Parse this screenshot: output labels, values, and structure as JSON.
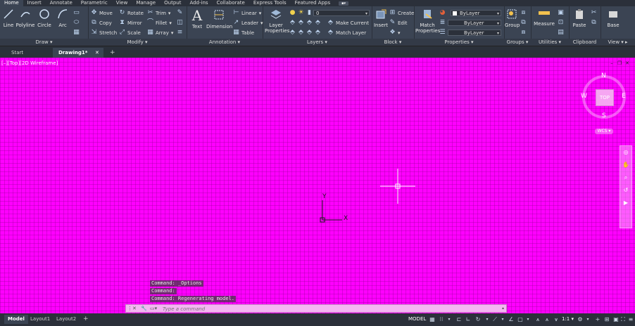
{
  "menu": {
    "items": [
      "Home",
      "Insert",
      "Annotate",
      "Parametric",
      "View",
      "Manage",
      "Output",
      "Add-ins",
      "Collaborate",
      "Express Tools",
      "Featured Apps"
    ],
    "active": "Home"
  },
  "ribbon": {
    "draw": {
      "title": "Draw",
      "line": "Line",
      "polyline": "Polyline",
      "circle": "Circle",
      "arc": "Arc"
    },
    "modify": {
      "title": "Modify",
      "move": "Move",
      "rotate": "Rotate",
      "trim": "Trim",
      "copy": "Copy",
      "mirror": "Mirror",
      "fillet": "Fillet",
      "stretch": "Stretch",
      "scale": "Scale",
      "array": "Array"
    },
    "annotation": {
      "title": "Annotation",
      "text": "Text",
      "dimension": "Dimension",
      "linear": "Linear",
      "leader": "Leader",
      "table": "Table"
    },
    "layers": {
      "title": "Layers",
      "layer_properties_1": "Layer",
      "layer_properties_2": "Properties",
      "layer_value": "0",
      "make_current": "Make Current",
      "match_layer": "Match Layer"
    },
    "block": {
      "title": "Block",
      "insert": "Insert",
      "create": "Create",
      "edit": "Edit"
    },
    "properties": {
      "title": "Properties",
      "match_1": "Match",
      "match_2": "Properties",
      "color": "ByLayer",
      "linetype": "ByLayer",
      "lineweight": "ByLayer"
    },
    "groups": {
      "title": "Groups",
      "group": "Group"
    },
    "utilities": {
      "title": "Utilities",
      "measure": "Measure"
    },
    "clipboard": {
      "title": "Clipboard",
      "paste": "Paste"
    },
    "view": {
      "title": "View",
      "base": "Base"
    }
  },
  "file_tabs": {
    "start": "Start",
    "drawing": "Drawing1*"
  },
  "viewport": {
    "label": "[–][Top][2D Wireframe]",
    "viewcube": {
      "top": "TOP",
      "n": "N",
      "s": "S",
      "e": "E",
      "w": "W",
      "wcs": "WCS"
    },
    "ucs": {
      "x": "X",
      "y": "Y"
    }
  },
  "command": {
    "history": [
      "Command: _Options",
      "Command:",
      "Command: Regenerating model."
    ],
    "placeholder": "Type a command"
  },
  "status": {
    "layouts": [
      "Model",
      "Layout1",
      "Layout2"
    ],
    "model": "MODEL",
    "scale": "1:1"
  },
  "colors": {
    "background": "#ff00ff",
    "ribbon": "#3b4453",
    "chrome": "#2b303a",
    "cmdbar": "#f4b6f2"
  }
}
